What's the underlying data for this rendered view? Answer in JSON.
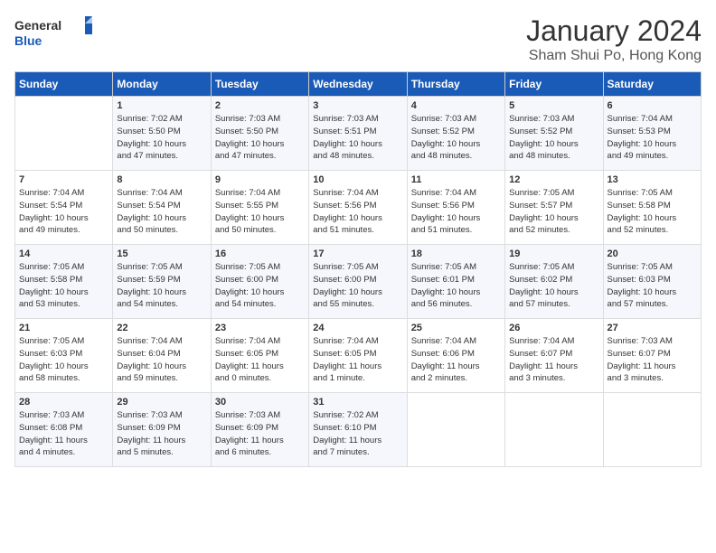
{
  "header": {
    "logo_general": "General",
    "logo_blue": "Blue",
    "month": "January 2024",
    "location": "Sham Shui Po, Hong Kong"
  },
  "weekdays": [
    "Sunday",
    "Monday",
    "Tuesday",
    "Wednesday",
    "Thursday",
    "Friday",
    "Saturday"
  ],
  "weeks": [
    [
      {
        "day": "",
        "info": ""
      },
      {
        "day": "1",
        "info": "Sunrise: 7:02 AM\nSunset: 5:50 PM\nDaylight: 10 hours\nand 47 minutes."
      },
      {
        "day": "2",
        "info": "Sunrise: 7:03 AM\nSunset: 5:50 PM\nDaylight: 10 hours\nand 47 minutes."
      },
      {
        "day": "3",
        "info": "Sunrise: 7:03 AM\nSunset: 5:51 PM\nDaylight: 10 hours\nand 48 minutes."
      },
      {
        "day": "4",
        "info": "Sunrise: 7:03 AM\nSunset: 5:52 PM\nDaylight: 10 hours\nand 48 minutes."
      },
      {
        "day": "5",
        "info": "Sunrise: 7:03 AM\nSunset: 5:52 PM\nDaylight: 10 hours\nand 48 minutes."
      },
      {
        "day": "6",
        "info": "Sunrise: 7:04 AM\nSunset: 5:53 PM\nDaylight: 10 hours\nand 49 minutes."
      }
    ],
    [
      {
        "day": "7",
        "info": "Sunrise: 7:04 AM\nSunset: 5:54 PM\nDaylight: 10 hours\nand 49 minutes."
      },
      {
        "day": "8",
        "info": "Sunrise: 7:04 AM\nSunset: 5:54 PM\nDaylight: 10 hours\nand 50 minutes."
      },
      {
        "day": "9",
        "info": "Sunrise: 7:04 AM\nSunset: 5:55 PM\nDaylight: 10 hours\nand 50 minutes."
      },
      {
        "day": "10",
        "info": "Sunrise: 7:04 AM\nSunset: 5:56 PM\nDaylight: 10 hours\nand 51 minutes."
      },
      {
        "day": "11",
        "info": "Sunrise: 7:04 AM\nSunset: 5:56 PM\nDaylight: 10 hours\nand 51 minutes."
      },
      {
        "day": "12",
        "info": "Sunrise: 7:05 AM\nSunset: 5:57 PM\nDaylight: 10 hours\nand 52 minutes."
      },
      {
        "day": "13",
        "info": "Sunrise: 7:05 AM\nSunset: 5:58 PM\nDaylight: 10 hours\nand 52 minutes."
      }
    ],
    [
      {
        "day": "14",
        "info": "Sunrise: 7:05 AM\nSunset: 5:58 PM\nDaylight: 10 hours\nand 53 minutes."
      },
      {
        "day": "15",
        "info": "Sunrise: 7:05 AM\nSunset: 5:59 PM\nDaylight: 10 hours\nand 54 minutes."
      },
      {
        "day": "16",
        "info": "Sunrise: 7:05 AM\nSunset: 6:00 PM\nDaylight: 10 hours\nand 54 minutes."
      },
      {
        "day": "17",
        "info": "Sunrise: 7:05 AM\nSunset: 6:00 PM\nDaylight: 10 hours\nand 55 minutes."
      },
      {
        "day": "18",
        "info": "Sunrise: 7:05 AM\nSunset: 6:01 PM\nDaylight: 10 hours\nand 56 minutes."
      },
      {
        "day": "19",
        "info": "Sunrise: 7:05 AM\nSunset: 6:02 PM\nDaylight: 10 hours\nand 57 minutes."
      },
      {
        "day": "20",
        "info": "Sunrise: 7:05 AM\nSunset: 6:03 PM\nDaylight: 10 hours\nand 57 minutes."
      }
    ],
    [
      {
        "day": "21",
        "info": "Sunrise: 7:05 AM\nSunset: 6:03 PM\nDaylight: 10 hours\nand 58 minutes."
      },
      {
        "day": "22",
        "info": "Sunrise: 7:04 AM\nSunset: 6:04 PM\nDaylight: 10 hours\nand 59 minutes."
      },
      {
        "day": "23",
        "info": "Sunrise: 7:04 AM\nSunset: 6:05 PM\nDaylight: 11 hours\nand 0 minutes."
      },
      {
        "day": "24",
        "info": "Sunrise: 7:04 AM\nSunset: 6:05 PM\nDaylight: 11 hours\nand 1 minute."
      },
      {
        "day": "25",
        "info": "Sunrise: 7:04 AM\nSunset: 6:06 PM\nDaylight: 11 hours\nand 2 minutes."
      },
      {
        "day": "26",
        "info": "Sunrise: 7:04 AM\nSunset: 6:07 PM\nDaylight: 11 hours\nand 3 minutes."
      },
      {
        "day": "27",
        "info": "Sunrise: 7:03 AM\nSunset: 6:07 PM\nDaylight: 11 hours\nand 3 minutes."
      }
    ],
    [
      {
        "day": "28",
        "info": "Sunrise: 7:03 AM\nSunset: 6:08 PM\nDaylight: 11 hours\nand 4 minutes."
      },
      {
        "day": "29",
        "info": "Sunrise: 7:03 AM\nSunset: 6:09 PM\nDaylight: 11 hours\nand 5 minutes."
      },
      {
        "day": "30",
        "info": "Sunrise: 7:03 AM\nSunset: 6:09 PM\nDaylight: 11 hours\nand 6 minutes."
      },
      {
        "day": "31",
        "info": "Sunrise: 7:02 AM\nSunset: 6:10 PM\nDaylight: 11 hours\nand 7 minutes."
      },
      {
        "day": "",
        "info": ""
      },
      {
        "day": "",
        "info": ""
      },
      {
        "day": "",
        "info": ""
      }
    ]
  ]
}
